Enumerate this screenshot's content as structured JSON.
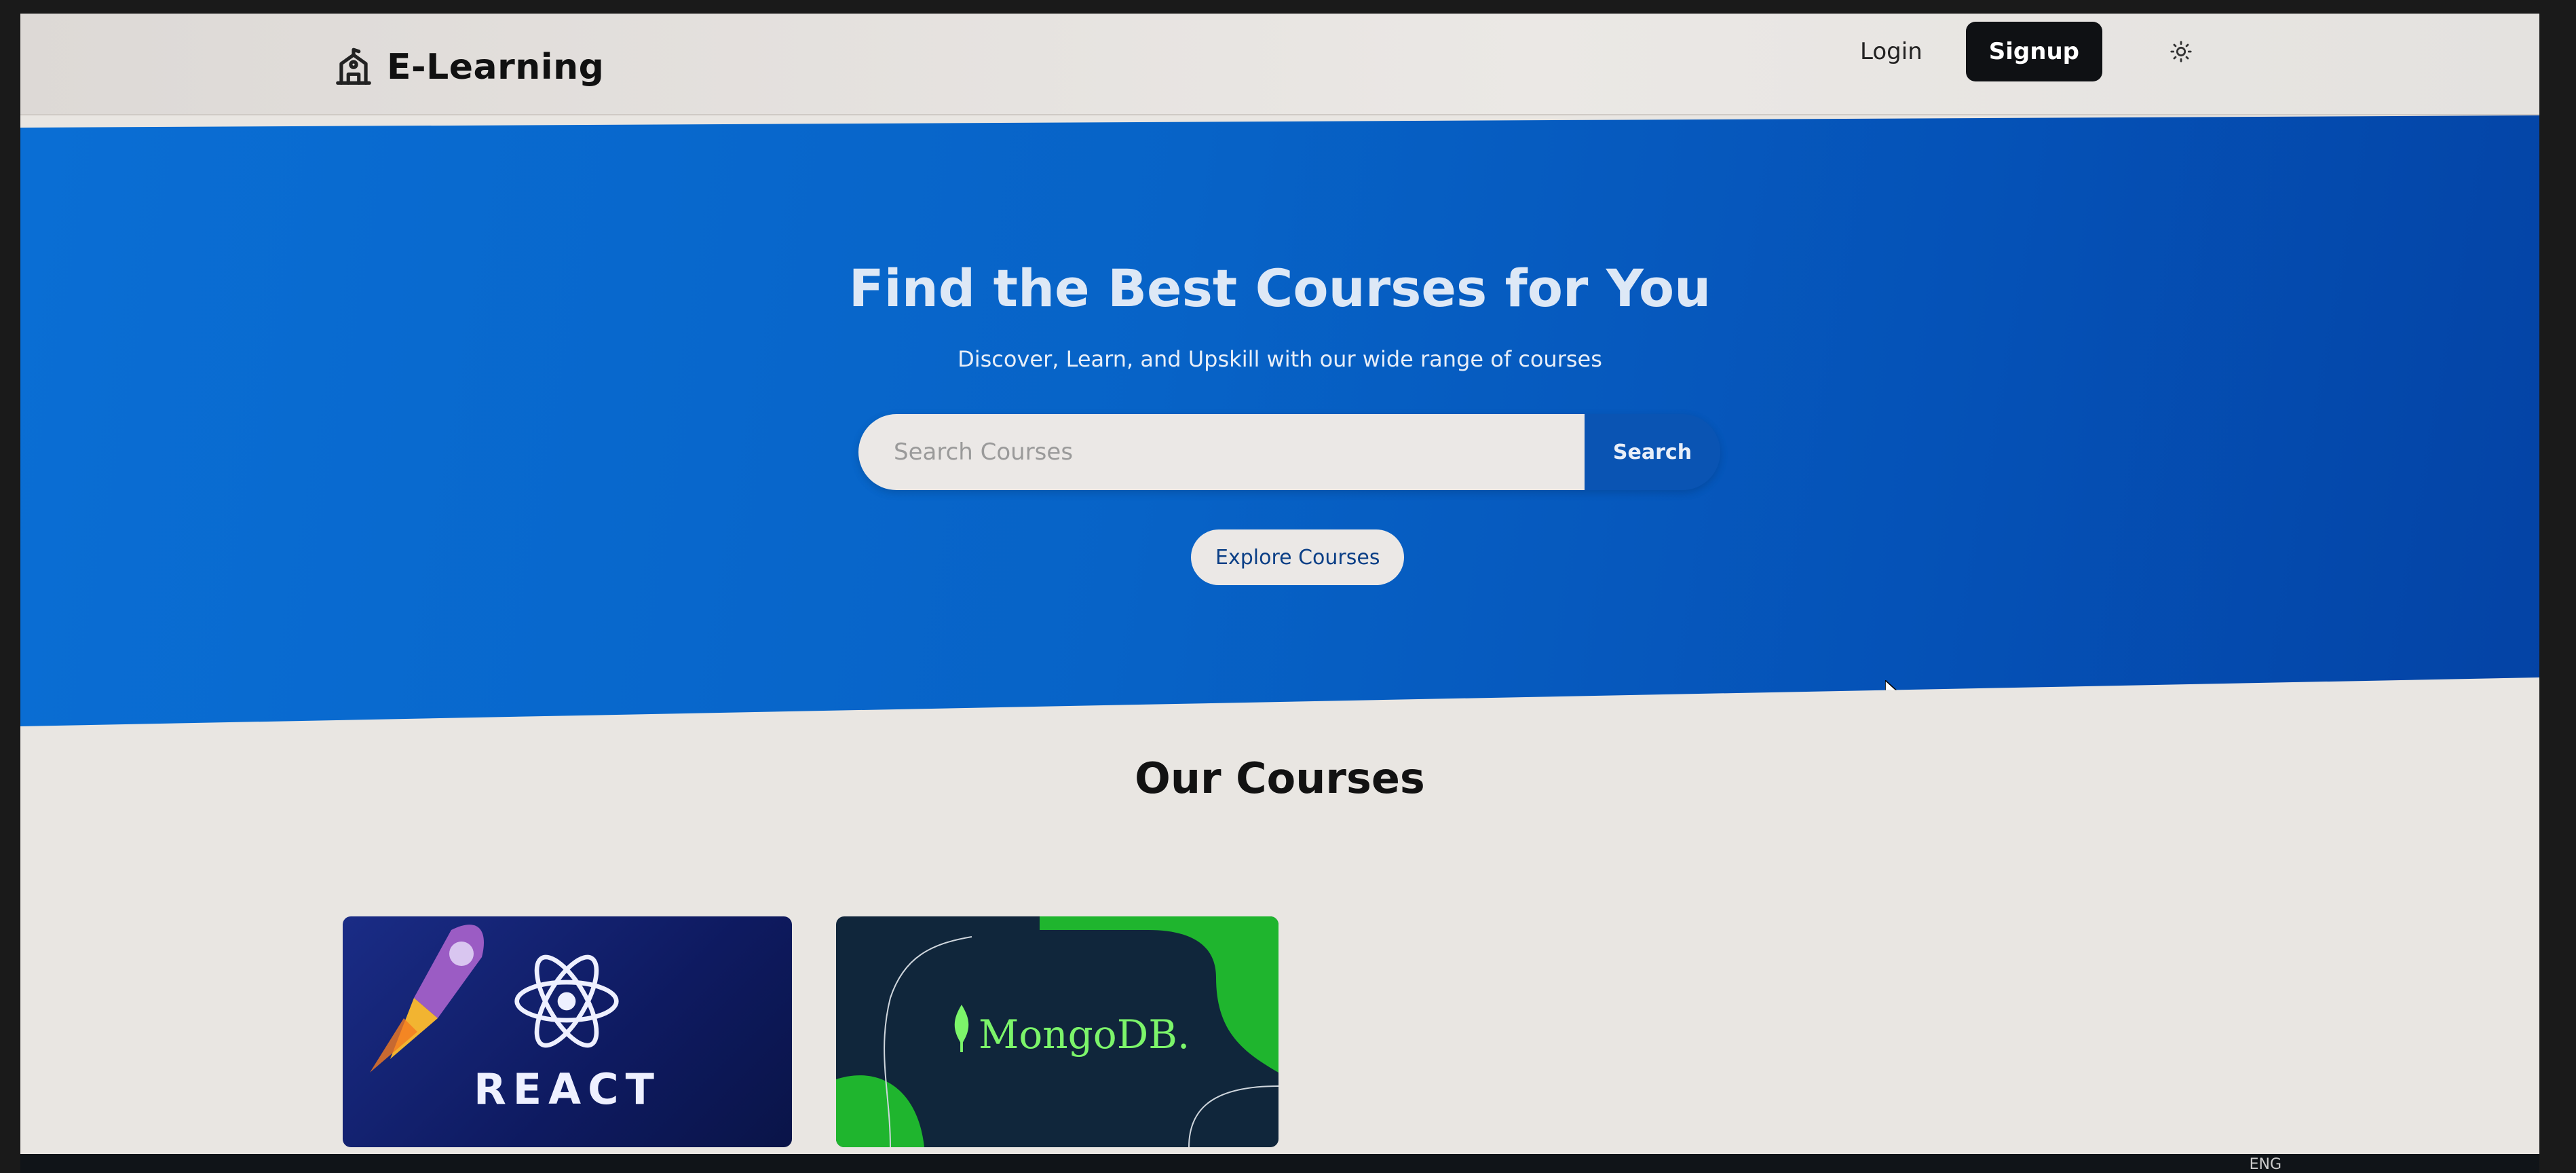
{
  "navbar": {
    "brand": "E-Learning",
    "login_label": "Login",
    "signup_label": "Signup"
  },
  "hero": {
    "title": "Find the Best Courses for You",
    "subtitle": "Discover, Learn, and Upskill with our wide range of courses",
    "search_placeholder": "Search Courses",
    "search_button": "Search",
    "explore_button": "Explore Courses"
  },
  "courses": {
    "title": "Our Courses",
    "items": [
      {
        "label": "REACT",
        "icon": "react-logo-icon"
      },
      {
        "label": "MongoDB.",
        "icon": "mongodb-leaf-icon"
      }
    ]
  },
  "taskbar": {
    "language": "ENG"
  },
  "colors": {
    "hero_blue": "#0763c7",
    "signup_bg": "#0f1114",
    "search_button": "#0a54b3"
  }
}
